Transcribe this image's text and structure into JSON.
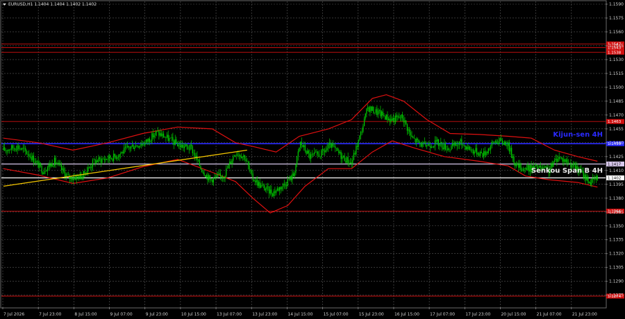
{
  "window": {
    "symbol_label": "EURUSD,H1  1.1404 1.1404 1.1402 1.1402"
  },
  "chart_data": {
    "type": "candlestick",
    "symbol": "EURUSD",
    "timeframe": "H1",
    "last_ohlc": {
      "open": 1.1404,
      "high": 1.1404,
      "low": 1.1402,
      "close": 1.1402
    },
    "ylim": [
      1.1262,
      1.1593
    ],
    "y_ticks": [
      1.159,
      1.1575,
      1.156,
      1.1545,
      1.153,
      1.1515,
      1.15,
      1.1485,
      1.147,
      1.1455,
      1.144,
      1.1425,
      1.141,
      1.1395,
      1.138,
      1.1365,
      1.135,
      1.1335,
      1.132,
      1.1305,
      1.129,
      1.1275
    ],
    "x_labels": [
      "7 Jul 2026",
      "7 Jul 23:00",
      "8 Jul 15:00",
      "9 Jul 07:00",
      "9 Jul 23:00",
      "10 Jul 15:00",
      "13 Jul 07:00",
      "13 Jul 23:00",
      "14 Jul 15:00",
      "15 Jul 07:00",
      "15 Jul 23:00",
      "16 Jul 15:00",
      "17 Jul 07:00",
      "17 Jul 23:00",
      "20 Jul 15:00",
      "21 Jul 07:00",
      "21 Jul 23:00"
    ],
    "grid": true,
    "levels": [
      {
        "price": 1.1547,
        "label": "1.1547",
        "color": "#d01010"
      },
      {
        "price": 1.1543,
        "label": "1.1543",
        "color": "#d01010"
      },
      {
        "price": 1.1538,
        "label": "1.1538",
        "color": "#d01010"
      },
      {
        "price": 1.1463,
        "label": "1.1463",
        "color": "#d01010"
      },
      {
        "price": 1.1439,
        "label": "1.1439",
        "color": "#2a2aff"
      },
      {
        "price": 1.1417,
        "label": "1.1417",
        "color": "#d8c8ec"
      },
      {
        "price": 1.1402,
        "label": "1.1402",
        "color": "#ffffff"
      },
      {
        "price": 1.1366,
        "label": "1.1366",
        "color": "#d01010"
      },
      {
        "price": 1.1274,
        "label": "1.1274",
        "color": "#d01010"
      }
    ],
    "annotations": [
      {
        "text": "Kijun-sen 4H",
        "price": 1.1449,
        "color": "#2a2aff"
      },
      {
        "text": "Senkou Span B 4H",
        "price": 1.141,
        "color": "#e8e8e8"
      }
    ],
    "trendline": {
      "from": {
        "bar": 0,
        "price": 1.1393
      },
      "to": {
        "bar": 210,
        "price": 1.1432
      },
      "color": "#f2c400"
    },
    "price_path": [
      {
        "bar": 0,
        "price": 1.1432
      },
      {
        "bar": 12,
        "price": 1.1436
      },
      {
        "bar": 22,
        "price": 1.1428
      },
      {
        "bar": 34,
        "price": 1.141
      },
      {
        "bar": 44,
        "price": 1.142
      },
      {
        "bar": 56,
        "price": 1.1402
      },
      {
        "bar": 68,
        "price": 1.1404
      },
      {
        "bar": 78,
        "price": 1.142
      },
      {
        "bar": 96,
        "price": 1.1425
      },
      {
        "bar": 110,
        "price": 1.1436
      },
      {
        "bar": 122,
        "price": 1.144
      },
      {
        "bar": 132,
        "price": 1.1451
      },
      {
        "bar": 140,
        "price": 1.1446
      },
      {
        "bar": 152,
        "price": 1.1437
      },
      {
        "bar": 162,
        "price": 1.1434
      },
      {
        "bar": 170,
        "price": 1.1413
      },
      {
        "bar": 178,
        "price": 1.14
      },
      {
        "bar": 190,
        "price": 1.1405
      },
      {
        "bar": 200,
        "price": 1.143
      },
      {
        "bar": 208,
        "price": 1.1425
      },
      {
        "bar": 214,
        "price": 1.1403
      },
      {
        "bar": 222,
        "price": 1.1393
      },
      {
        "bar": 232,
        "price": 1.1386
      },
      {
        "bar": 242,
        "price": 1.1395
      },
      {
        "bar": 250,
        "price": 1.1405
      },
      {
        "bar": 256,
        "price": 1.144
      },
      {
        "bar": 264,
        "price": 1.1425
      },
      {
        "bar": 274,
        "price": 1.1428
      },
      {
        "bar": 282,
        "price": 1.1437
      },
      {
        "bar": 292,
        "price": 1.1425
      },
      {
        "bar": 300,
        "price": 1.1418
      },
      {
        "bar": 308,
        "price": 1.145
      },
      {
        "bar": 314,
        "price": 1.1478
      },
      {
        "bar": 324,
        "price": 1.1472
      },
      {
        "bar": 334,
        "price": 1.1465
      },
      {
        "bar": 344,
        "price": 1.1468
      },
      {
        "bar": 352,
        "price": 1.1445
      },
      {
        "bar": 362,
        "price": 1.1437
      },
      {
        "bar": 374,
        "price": 1.144
      },
      {
        "bar": 384,
        "price": 1.1434
      },
      {
        "bar": 394,
        "price": 1.144
      },
      {
        "bar": 404,
        "price": 1.1432
      },
      {
        "bar": 414,
        "price": 1.1428
      },
      {
        "bar": 424,
        "price": 1.1442
      },
      {
        "bar": 434,
        "price": 1.144
      },
      {
        "bar": 442,
        "price": 1.1415
      },
      {
        "bar": 450,
        "price": 1.1412
      },
      {
        "bar": 460,
        "price": 1.1413
      },
      {
        "bar": 470,
        "price": 1.141
      },
      {
        "bar": 478,
        "price": 1.1425
      },
      {
        "bar": 488,
        "price": 1.1418
      },
      {
        "bar": 498,
        "price": 1.1408
      },
      {
        "bar": 506,
        "price": 1.1397
      },
      {
        "bar": 512,
        "price": 1.1402
      }
    ],
    "envelope_upper": [
      {
        "bar": 0,
        "price": 1.1445
      },
      {
        "bar": 30,
        "price": 1.144
      },
      {
        "bar": 60,
        "price": 1.1432
      },
      {
        "bar": 90,
        "price": 1.144
      },
      {
        "bar": 120,
        "price": 1.145
      },
      {
        "bar": 150,
        "price": 1.1457
      },
      {
        "bar": 180,
        "price": 1.1455
      },
      {
        "bar": 200,
        "price": 1.144
      },
      {
        "bar": 215,
        "price": 1.1436
      },
      {
        "bar": 235,
        "price": 1.143
      },
      {
        "bar": 255,
        "price": 1.1447
      },
      {
        "bar": 280,
        "price": 1.1455
      },
      {
        "bar": 300,
        "price": 1.1465
      },
      {
        "bar": 318,
        "price": 1.1488
      },
      {
        "bar": 330,
        "price": 1.1492
      },
      {
        "bar": 345,
        "price": 1.1485
      },
      {
        "bar": 365,
        "price": 1.1465
      },
      {
        "bar": 385,
        "price": 1.145
      },
      {
        "bar": 410,
        "price": 1.1449
      },
      {
        "bar": 435,
        "price": 1.1447
      },
      {
        "bar": 455,
        "price": 1.1445
      },
      {
        "bar": 475,
        "price": 1.1432
      },
      {
        "bar": 495,
        "price": 1.1425
      },
      {
        "bar": 512,
        "price": 1.142
      }
    ],
    "envelope_lower": [
      {
        "bar": 0,
        "price": 1.1412
      },
      {
        "bar": 30,
        "price": 1.1405
      },
      {
        "bar": 60,
        "price": 1.1396
      },
      {
        "bar": 90,
        "price": 1.1402
      },
      {
        "bar": 120,
        "price": 1.1414
      },
      {
        "bar": 150,
        "price": 1.1422
      },
      {
        "bar": 180,
        "price": 1.1408
      },
      {
        "bar": 200,
        "price": 1.1398
      },
      {
        "bar": 215,
        "price": 1.138
      },
      {
        "bar": 230,
        "price": 1.1364
      },
      {
        "bar": 245,
        "price": 1.1372
      },
      {
        "bar": 260,
        "price": 1.1393
      },
      {
        "bar": 280,
        "price": 1.1412
      },
      {
        "bar": 300,
        "price": 1.1412
      },
      {
        "bar": 318,
        "price": 1.143
      },
      {
        "bar": 335,
        "price": 1.1442
      },
      {
        "bar": 355,
        "price": 1.1434
      },
      {
        "bar": 380,
        "price": 1.1425
      },
      {
        "bar": 410,
        "price": 1.142
      },
      {
        "bar": 435,
        "price": 1.1415
      },
      {
        "bar": 450,
        "price": 1.1404
      },
      {
        "bar": 470,
        "price": 1.14
      },
      {
        "bar": 495,
        "price": 1.1397
      },
      {
        "bar": 512,
        "price": 1.1392
      }
    ],
    "colors": {
      "background": "#000000",
      "grid": "#5a5a5a",
      "candle": "#00d000",
      "envelope": "#e01010",
      "axis_text": "#d0d0d0"
    }
  }
}
